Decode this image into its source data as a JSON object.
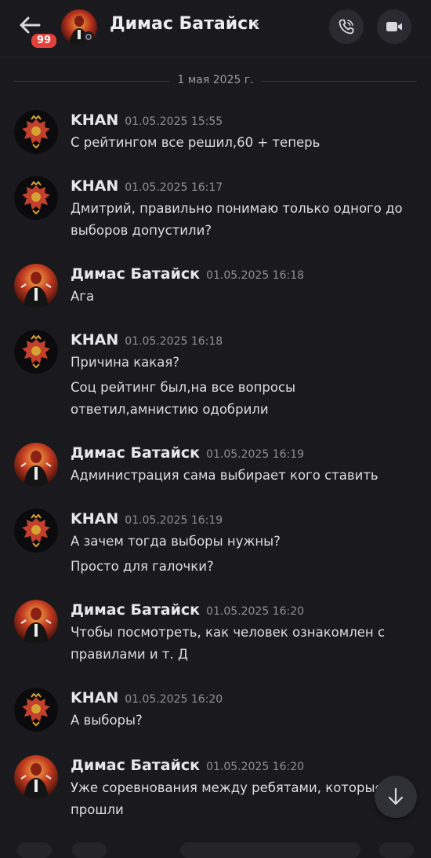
{
  "header": {
    "title": "Димас Батайск",
    "chevron": "›",
    "unread_count": "99",
    "icons": {
      "back": "arrow-left-icon",
      "call": "phone-icon",
      "video": "video-camera-icon"
    }
  },
  "colors": {
    "background": "#1a1a1e",
    "badge": "#e2403c",
    "divider": "#3a3a40"
  },
  "date_divider": "1 мая 2025 г.",
  "messages": [
    {
      "author": "KHAN",
      "time": "01.05.2025 15:55",
      "avatar": "eagle-emblem",
      "lines": [
        "С рейтингом все решил,60 + теперь"
      ]
    },
    {
      "author": "KHAN",
      "time": "01.05.2025 16:17",
      "avatar": "eagle-emblem",
      "lines": [
        "Дмитрий, правильно понимаю только одного до",
        "выборов допустили?"
      ]
    },
    {
      "author": "Димас Батайск",
      "time": "01.05.2025 16:18",
      "avatar": "red-figure",
      "lines": [
        "Ага"
      ]
    },
    {
      "author": "KHAN",
      "time": "01.05.2025 16:18",
      "avatar": "eagle-emblem",
      "lines": [
        "Причина какая?",
        "Соц рейтинг был,на все вопросы",
        "ответил,амнистию одобрили"
      ]
    },
    {
      "author": "Димас Батайск",
      "time": "01.05.2025 16:19",
      "avatar": "red-figure",
      "lines": [
        "Администрация сама выбирает кого ставить"
      ]
    },
    {
      "author": "KHAN",
      "time": "01.05.2025 16:19",
      "avatar": "eagle-emblem",
      "lines": [
        "А зачем тогда выборы нужны?",
        "Просто для галочки?"
      ]
    },
    {
      "author": "Димас Батайск",
      "time": "01.05.2025 16:20",
      "avatar": "red-figure",
      "lines": [
        "Чтобы посмотреть, как человек ознакомлен с",
        "правилами и т. Д"
      ]
    },
    {
      "author": "KHAN",
      "time": "01.05.2025 16:20",
      "avatar": "eagle-emblem",
      "lines": [
        "А выборы?"
      ]
    },
    {
      "author": "Димас Батайск",
      "time": "01.05.2025 16:20",
      "avatar": "red-figure",
      "lines": [
        "Уже соревнования между ребятами, которые",
        "прошли"
      ]
    }
  ],
  "scroll_down_icon": "arrow-down-icon"
}
